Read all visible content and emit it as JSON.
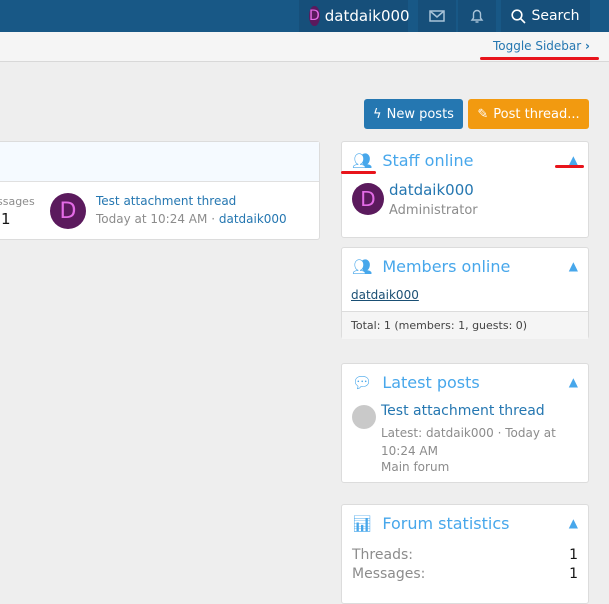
{
  "header": {
    "username": "datdaik000",
    "avatar_letter": "D",
    "search_label": "Search",
    "icons": [
      "envelope-icon",
      "bell-icon",
      "search-icon"
    ]
  },
  "subnav": {
    "toggle_sidebar": "Toggle Sidebar"
  },
  "actions": {
    "new_posts": "New posts",
    "post_thread": "Post thread...",
    "colors": {
      "new_posts": "#2577b1",
      "post_thread": "#f29a10"
    }
  },
  "main": {
    "messages_label": "ssages",
    "messages_count": "1",
    "latest": {
      "avatar_letter": "D",
      "title": "Test attachment thread",
      "time": "Today at 10:24 AM",
      "separator": "·",
      "user": "datdaik000"
    }
  },
  "sidebar": {
    "staff": {
      "title": "Staff online",
      "user": "datdaik000",
      "avatar_letter": "D",
      "role": "Administrator"
    },
    "members": {
      "title": "Members online",
      "user": "datdaik000",
      "total": "Total: 1 (members: 1, guests: 0)"
    },
    "latest_posts": {
      "title": "Latest posts",
      "thread": "Test attachment thread",
      "meta": "Latest: datdaik000 · Today at 10:24 AM",
      "forum": "Main forum"
    },
    "stats": {
      "title": "Forum statistics",
      "rows": [
        {
          "label": "Threads:",
          "value": "1"
        },
        {
          "label": "Messages:",
          "value": "1"
        }
      ]
    }
  }
}
